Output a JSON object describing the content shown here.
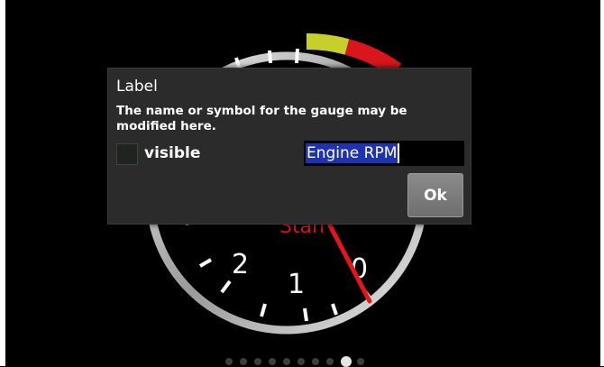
{
  "gauge": {
    "visible_tick_labels": [
      "2",
      "1",
      "0"
    ],
    "partial_text": "Stan",
    "needle_color": "#e8141b",
    "redline_color": "#d8161c",
    "warning_color": "#c7d02a",
    "needle_icon": "needle-icon"
  },
  "dialog": {
    "title": "Label",
    "message": "The name or symbol for the gauge may be modified here.",
    "visible_label": "visible",
    "visible_checked": false,
    "input_value": "Engine RPM",
    "ok_label": "Ok",
    "selection_color": "#1e33b4"
  },
  "pager": {
    "count": 10,
    "active_index": 8
  }
}
